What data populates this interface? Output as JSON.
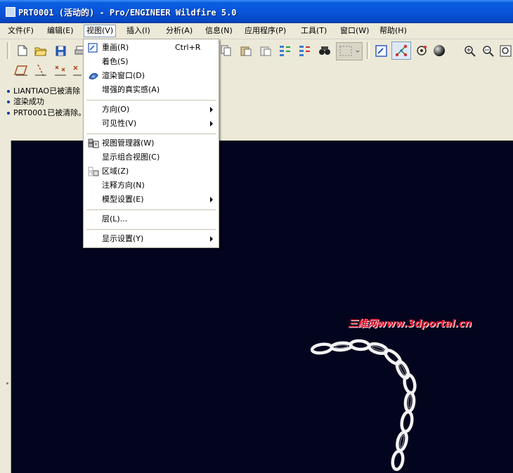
{
  "window": {
    "title": "PRT0001 (活动的) - Pro/ENGINEER Wildfire 5.0"
  },
  "menubar": {
    "items": [
      {
        "label": "文件(F)"
      },
      {
        "label": "编辑(E)"
      },
      {
        "label": "视图(V)"
      },
      {
        "label": "插入(I)"
      },
      {
        "label": "分析(A)"
      },
      {
        "label": "信息(N)"
      },
      {
        "label": "应用程序(P)"
      },
      {
        "label": "工具(T)"
      },
      {
        "label": "窗口(W)"
      },
      {
        "label": "帮助(H)"
      }
    ]
  },
  "view_menu": {
    "items": [
      {
        "label": "重画(R)",
        "shortcut": "Ctrl+R",
        "icon": "repaint-icon",
        "submenu": false
      },
      {
        "label": "着色(S)",
        "shortcut": "",
        "icon": "",
        "submenu": false
      },
      {
        "label": "渲染窗口(D)",
        "shortcut": "",
        "icon": "render-window-icon",
        "submenu": false
      },
      {
        "label": "增强的真实感(A)",
        "shortcut": "",
        "icon": "",
        "submenu": false
      },
      {
        "label": "方向(O)",
        "shortcut": "",
        "icon": "",
        "submenu": true
      },
      {
        "label": "可见性(V)",
        "shortcut": "",
        "icon": "",
        "submenu": true
      },
      {
        "label": "视图管理器(W)",
        "shortcut": "",
        "icon": "view-manager-icon",
        "submenu": false
      },
      {
        "label": "显示组合视图(C)",
        "shortcut": "",
        "icon": "",
        "submenu": false
      },
      {
        "label": "区域(Z)",
        "shortcut": "",
        "icon": "zone-icon",
        "submenu": false
      },
      {
        "label": "注释方向(N)",
        "shortcut": "",
        "icon": "",
        "submenu": false
      },
      {
        "label": "模型设置(E)",
        "shortcut": "",
        "icon": "",
        "submenu": true
      },
      {
        "label": "层(L)...",
        "shortcut": "",
        "icon": "",
        "submenu": false
      },
      {
        "label": "显示设置(Y)",
        "shortcut": "",
        "icon": "",
        "submenu": true
      }
    ]
  },
  "messages": [
    {
      "text": "LIANTIAO已被清除"
    },
    {
      "text": "渲染成功"
    },
    {
      "text": "PRT0001已被清除。"
    }
  ],
  "toolbar_icons": [
    "new-file-icon",
    "open-folder-icon",
    "save-icon",
    "print-icon",
    "copy-icon",
    "paste-icon",
    "paste-special-icon",
    "regenerate-icon",
    "regenerate-manager-icon",
    "find-icon",
    "select-box-icon",
    "repaint-icon",
    "spin-center-icon",
    "orient-mode-icon",
    "shading-sphere-icon",
    "zoom-in-icon",
    "zoom-out-icon",
    "refit-icon",
    "datum-plane-icon",
    "datum-axis-icon",
    "datum-point-icon",
    "coordinate-system-icon"
  ],
  "watermark": {
    "text": "三维网www.3dportal.cn"
  },
  "colors": {
    "title_bar": "#0854d9",
    "viewport": "#03041e",
    "chain": "#f2f2f2",
    "watermark": "#e0102a"
  }
}
